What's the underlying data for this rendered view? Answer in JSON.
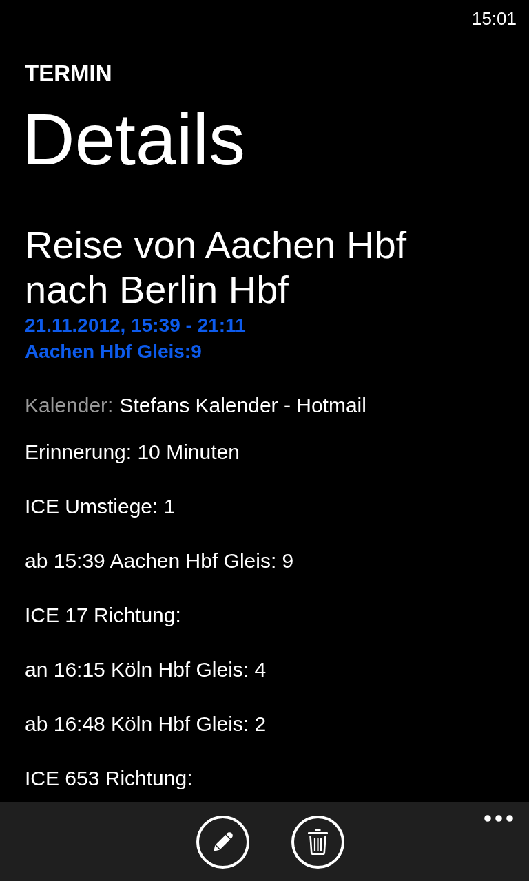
{
  "status_bar": {
    "time": "15:01"
  },
  "header": {
    "app_title": "TERMIN",
    "page_title": "Details"
  },
  "appointment": {
    "title": "Reise von Aachen Hbf nach Berlin Hbf",
    "when": "21.11.2012, 15:39 - 21:11",
    "where": "Aachen Hbf Gleis:9"
  },
  "calendar": {
    "label": "Kalender:",
    "value": "Stefans Kalender - Hotmail"
  },
  "reminder": "Erinnerung: 10 Minuten",
  "notes": [
    "ICE Umstiege: 1",
    "ab 15:39 Aachen Hbf Gleis: 9",
    "ICE 17 Richtung:",
    "an 16:15 Köln Hbf Gleis: 4",
    "ab 16:48 Köln Hbf Gleis: 2",
    "ICE 653 Richtung:"
  ],
  "app_bar": {
    "buttons": [
      {
        "kind": "edit"
      },
      {
        "kind": "delete"
      }
    ]
  }
}
